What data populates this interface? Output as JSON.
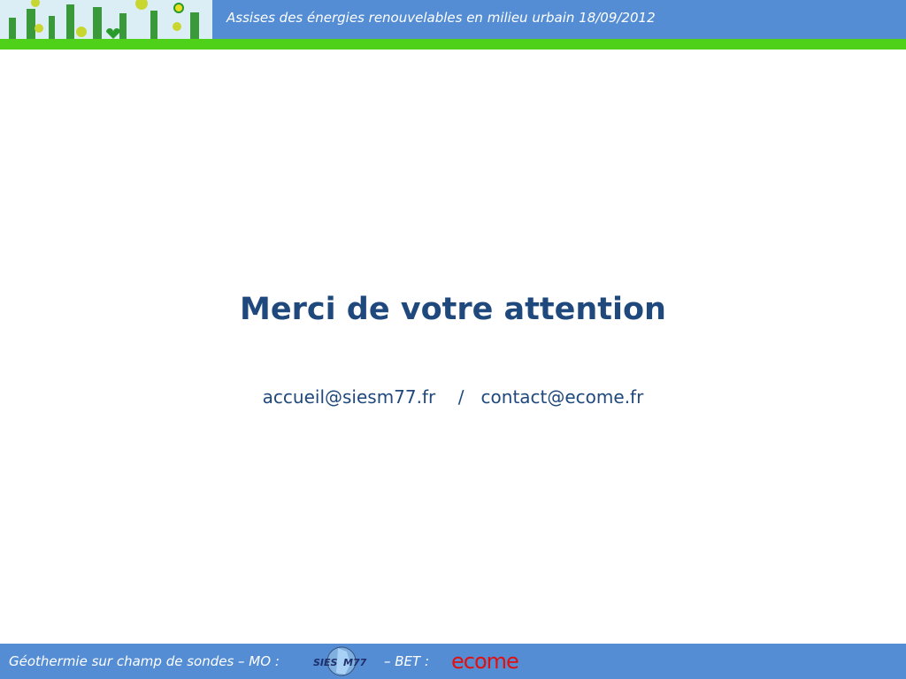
{
  "header": {
    "title": "Assises des énergies renouvelables en milieu urbain 18/09/2012"
  },
  "main": {
    "heading": "Merci de votre attention",
    "email1": "accueil@siesm77.fr",
    "separator": "/",
    "email2": "contact@ecome.fr"
  },
  "footer": {
    "text": "Géothermie sur champ de sondes  –  MO :",
    "sies_logo": "SIESM77",
    "bet": "–   BET :",
    "ecome_logo": "ecome"
  },
  "colors": {
    "blue": "#548dd4",
    "green": "#4fd11a",
    "title": "#1f497d",
    "ecome": "#e01010"
  }
}
